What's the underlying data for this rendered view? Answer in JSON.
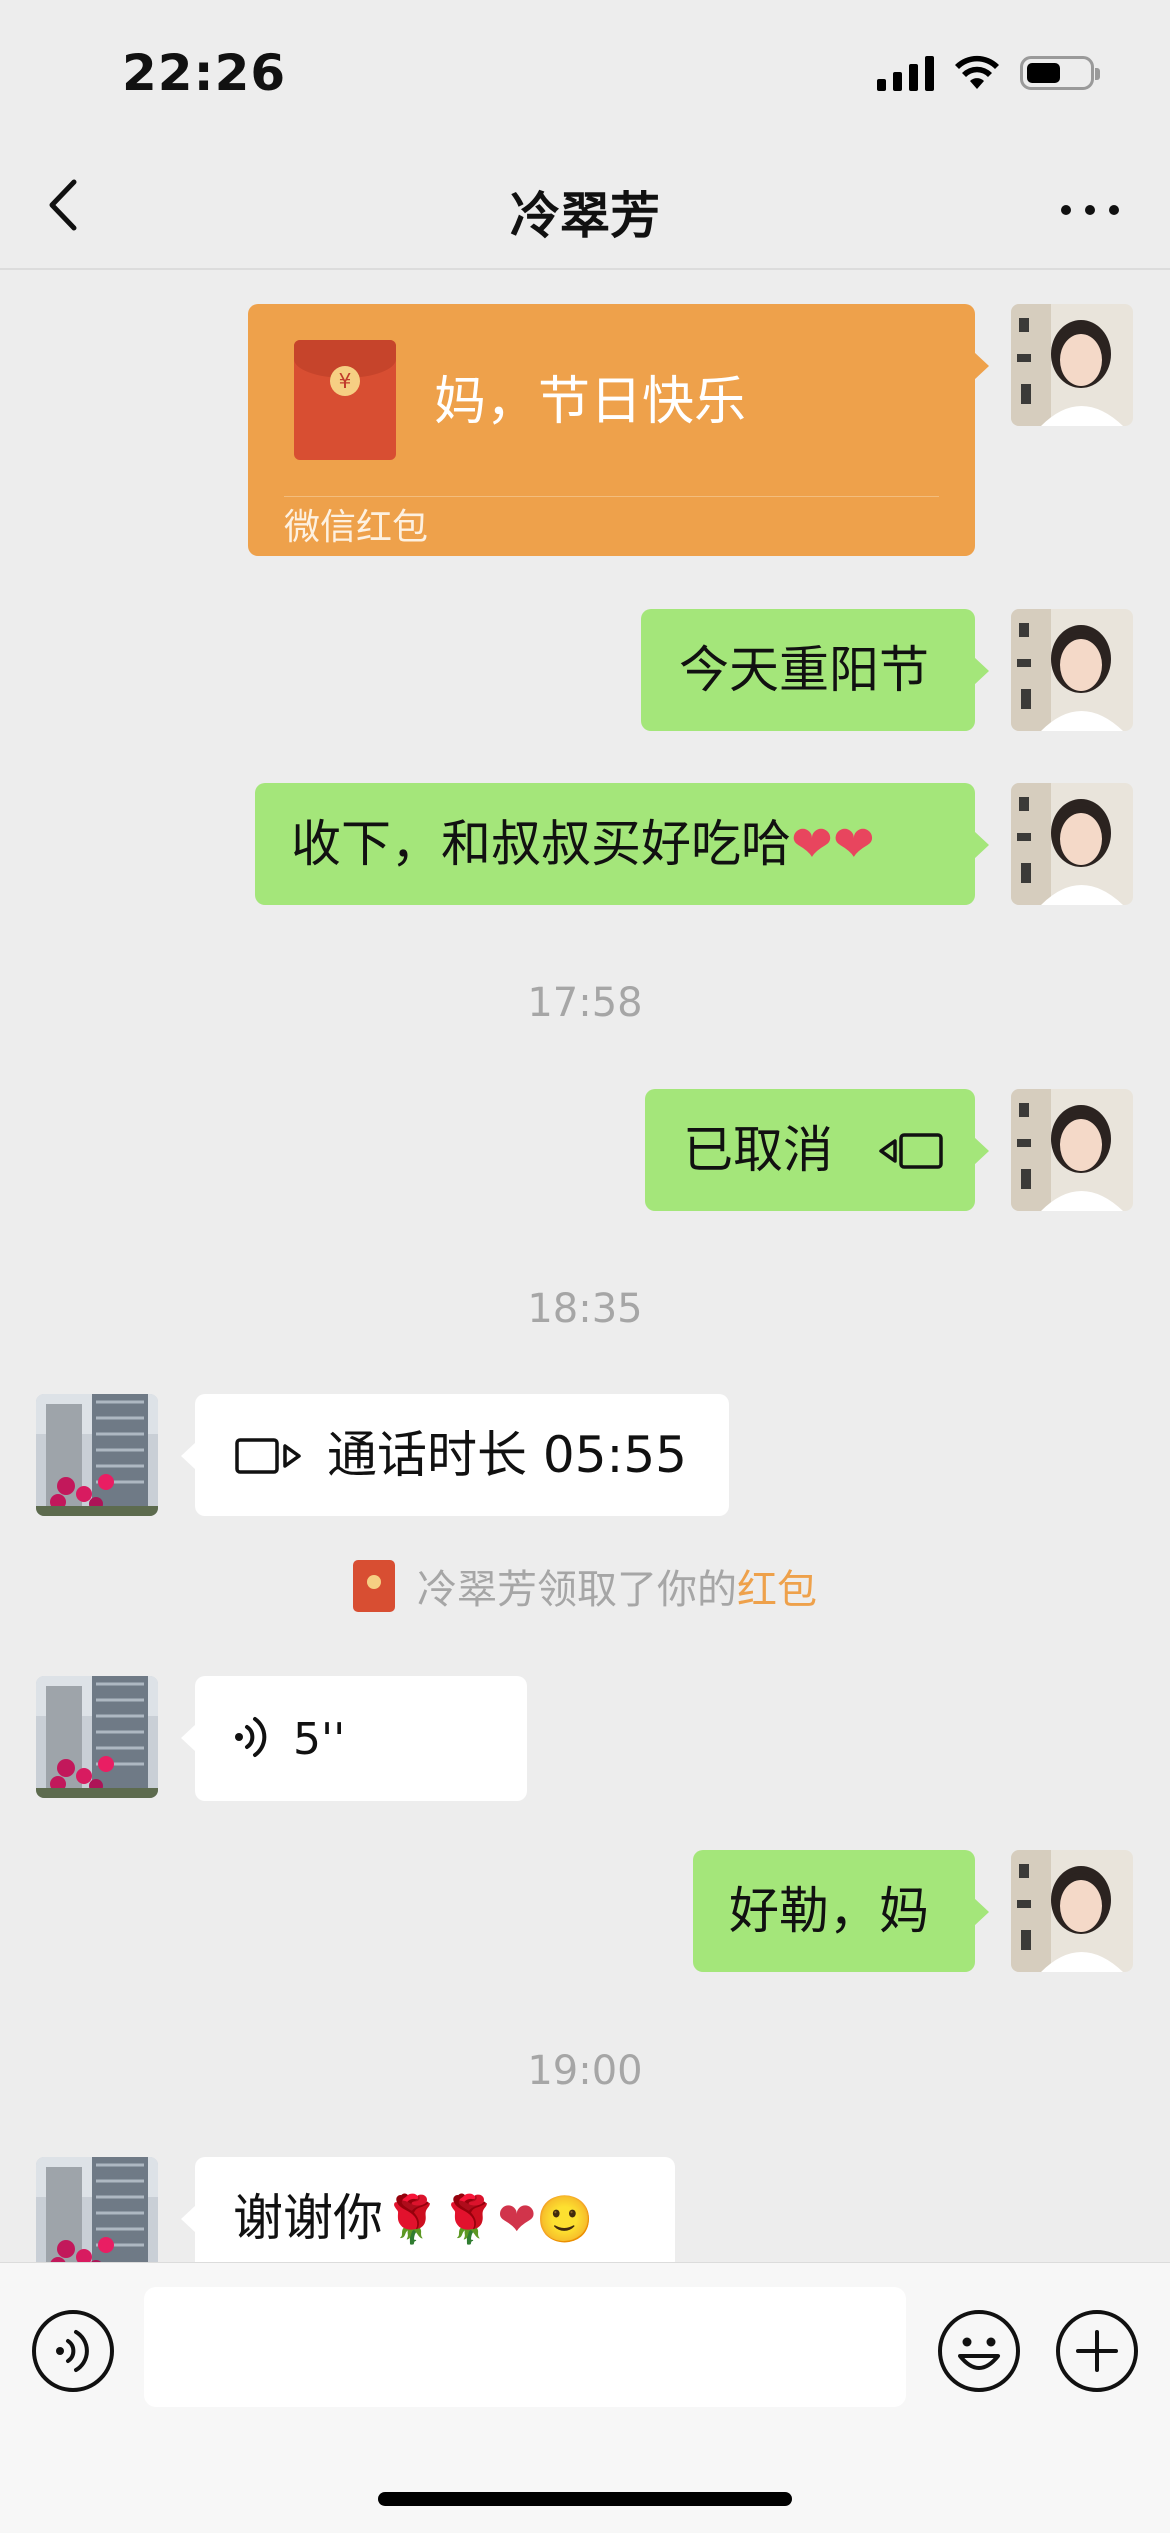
{
  "status_bar": {
    "time": "22:26",
    "battery_level": 0.55
  },
  "header": {
    "title": "冷翠芳"
  },
  "messages": {
    "red_packet": {
      "greeting": "妈，节日快乐",
      "label": "微信红包"
    },
    "m1": "今天重阳节",
    "m2": "收下，和叔叔买好吃哈",
    "m2_emoji": "❤❤",
    "ts1": "17:58",
    "cancelled_call": "已取消",
    "ts2": "18:35",
    "video_call": "通话时长 05:55",
    "notice": {
      "text": "冷翠芳领取了你的",
      "link": "红包"
    },
    "voice_duration": "5''",
    "m3": "好勒，妈",
    "ts3": "19:00",
    "m4": "谢谢你",
    "m4_emoji": "🌹🌹❤🙂"
  },
  "input": {
    "placeholder": ""
  },
  "colors": {
    "accent_green": "#a4e67a",
    "red_packet": "#eea14b",
    "link_orange": "#eea14b",
    "background": "#ededed"
  },
  "icons": [
    "back-icon",
    "more-icon",
    "video-call-icon",
    "voice-icon",
    "emoji-icon",
    "plus-icon"
  ]
}
